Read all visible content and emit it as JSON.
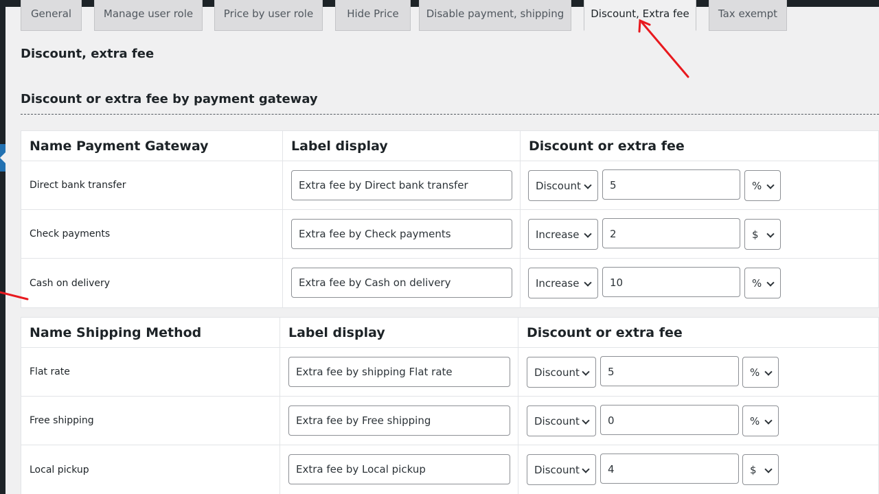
{
  "tabs": [
    {
      "label": "General"
    },
    {
      "label": "Manage user role"
    },
    {
      "label": "Price by user role"
    },
    {
      "label": "Hide Price"
    },
    {
      "label": "Disable payment, shipping"
    },
    {
      "label": "Discount, Extra fee"
    },
    {
      "label": "Tax exempt"
    }
  ],
  "active_tab": "Discount, Extra fee",
  "page_title": "Discount, extra fee",
  "section_title": "Discount or extra fee by payment gateway",
  "payment_table": {
    "headers": [
      "Name Payment Gateway",
      "Label display",
      "Discount or extra fee"
    ],
    "rows": [
      {
        "name": "Direct bank transfer",
        "label": "Extra fee by Direct bank transfer",
        "type": "Discount",
        "value": "5",
        "unit": "%"
      },
      {
        "name": "Check payments",
        "label": "Extra fee by Check payments",
        "type": "Increase",
        "value": "2",
        "unit": "$"
      },
      {
        "name": "Cash on delivery",
        "label": "Extra fee by Cash on delivery",
        "type": "Increase",
        "value": "10",
        "unit": "%"
      }
    ]
  },
  "shipping_table": {
    "headers": [
      "Name Shipping Method",
      "Label display",
      "Discount or extra fee"
    ],
    "rows": [
      {
        "name": "Flat rate",
        "label": "Extra fee by shipping Flat rate",
        "type": "Discount",
        "value": "5",
        "unit": "%"
      },
      {
        "name": "Free shipping",
        "label": "Extra fee by Free shipping",
        "type": "Discount",
        "value": "0",
        "unit": "%"
      },
      {
        "name": "Local pickup",
        "label": "Extra fee by Local pickup",
        "type": "Discount",
        "value": "4",
        "unit": "$"
      }
    ]
  },
  "colors": {
    "annotation_arrow": "#e8191e",
    "admin_bar": "#1d2327",
    "accent": "#2271b1"
  },
  "icons": [
    "chevron-down-icon",
    "annotation-arrow"
  ]
}
